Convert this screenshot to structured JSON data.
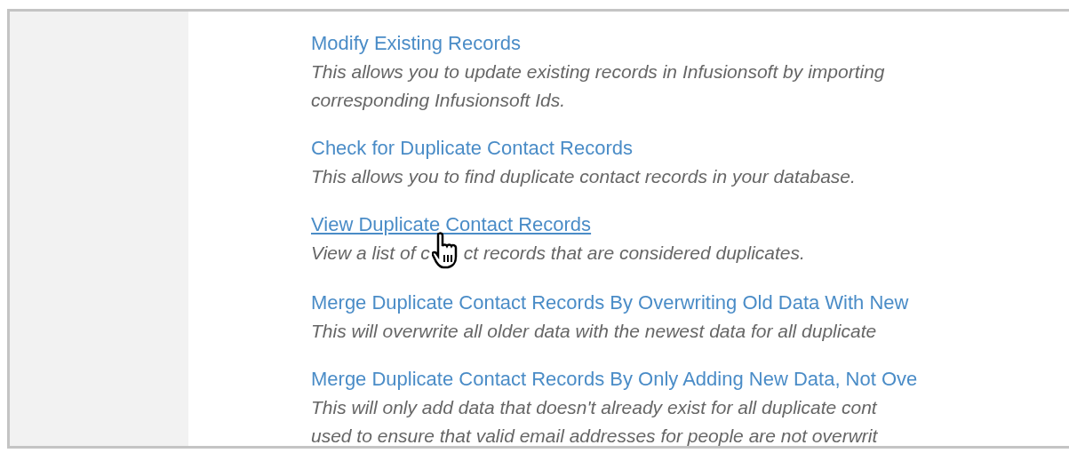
{
  "options": [
    {
      "title": "Modify Existing Records",
      "hovered": false,
      "description": [
        "This allows you to update existing records in Infusionsoft by importing",
        "corresponding Infusionsoft Ids."
      ]
    },
    {
      "title": "Check for Duplicate Contact Records",
      "hovered": false,
      "description": [
        "This allows you to find duplicate contact records in your database."
      ]
    },
    {
      "title": "View Duplicate Contact Records",
      "hovered": true,
      "description": [
        [
          "View a list of c",
          "ct records that are considered duplicates."
        ]
      ]
    },
    {
      "title": "Merge Duplicate Contact Records By Overwriting Old Data With New",
      "hovered": false,
      "description": [
        "This will overwrite all older data with the newest data for all duplicate"
      ]
    },
    {
      "title": "Merge Duplicate Contact Records By Only Adding New Data, Not Ove",
      "hovered": false,
      "description": [
        "This will only add data that doesn't already exist for all duplicate cont",
        "used to ensure that valid email addresses for people are not overwrit"
      ]
    }
  ]
}
